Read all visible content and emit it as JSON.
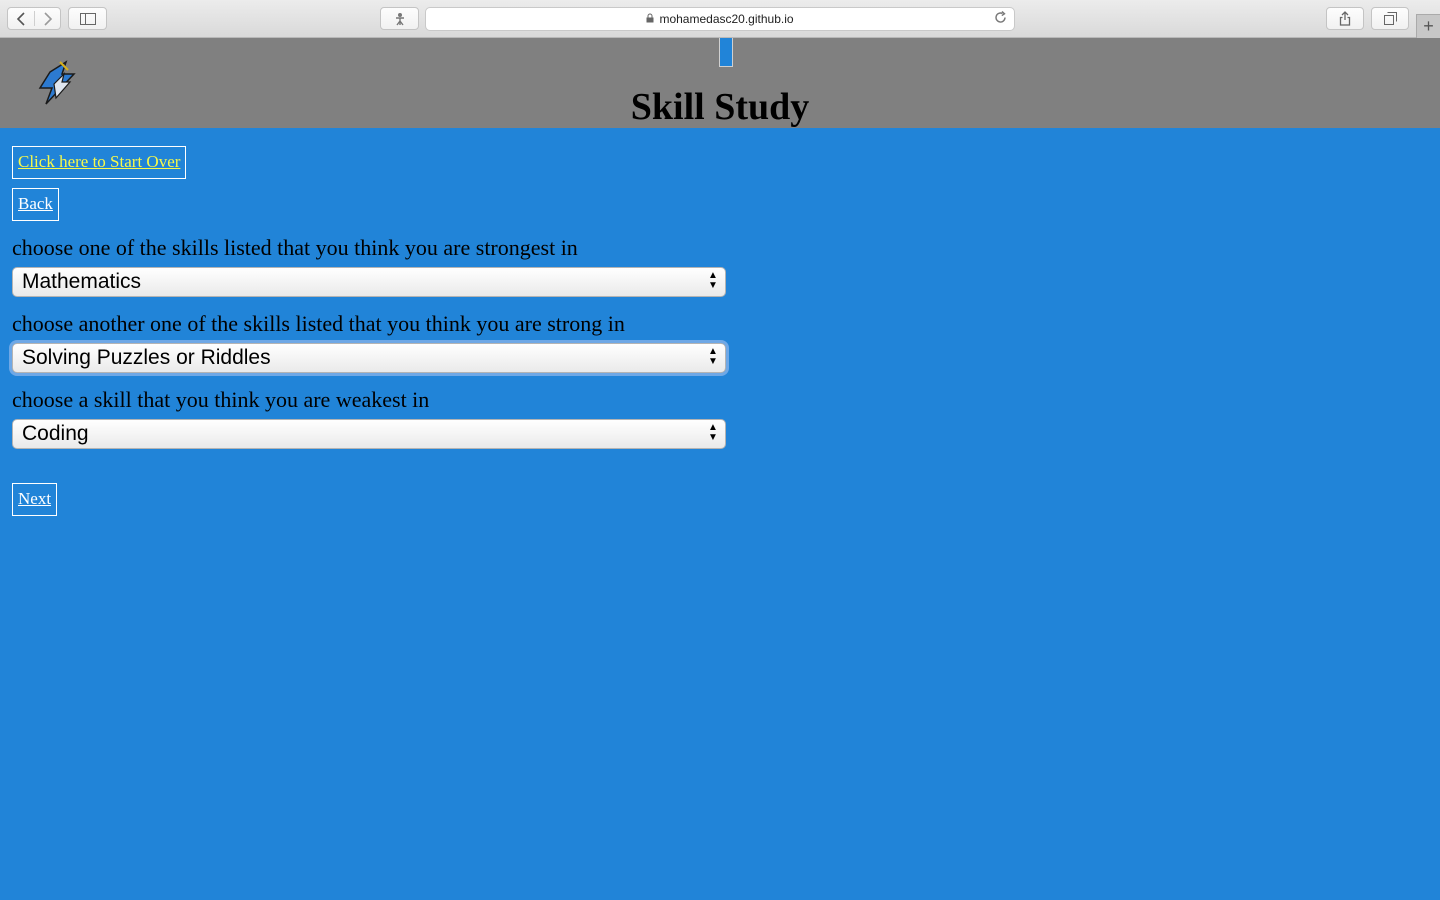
{
  "browser": {
    "url": "mohamedasc20.github.io",
    "icons": {
      "back": "chevron-left-icon",
      "forward": "chevron-right-icon",
      "sidebar": "sidebar-icon",
      "reader": "reader-icon",
      "lock": "lock-icon",
      "reload": "reload-icon",
      "share": "share-icon",
      "tabs": "tabs-icon",
      "new_tab": "plus-icon"
    }
  },
  "header": {
    "title": "Skill Study",
    "background": "#808080"
  },
  "colors": {
    "page_background": "#2184d8",
    "start_over_link": "#f6f94b",
    "link": "#ffffff"
  },
  "nav": {
    "start_over_label": "Click here to Start Over",
    "back_label": "Back",
    "next_label": "Next"
  },
  "questions": [
    {
      "label": "choose one of the skills listed that you think you are strongest in",
      "selected": "Mathematics"
    },
    {
      "label": "choose another one of the skills listed that you think you are strong in",
      "selected": "Solving Puzzles or Riddles"
    },
    {
      "label": "choose a skill that you think you are weakest in",
      "selected": "Coding"
    }
  ]
}
